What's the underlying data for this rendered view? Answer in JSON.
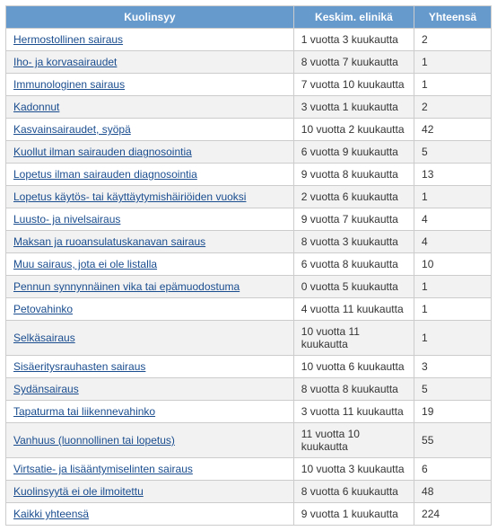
{
  "headers": {
    "cause": "Kuolinsyy",
    "avg_life": "Keskim. elinikä",
    "total": "Yhteensä"
  },
  "rows": [
    {
      "cause": "Hermostollinen sairaus",
      "avg_life": "1 vuotta 3 kuukautta",
      "total": "2"
    },
    {
      "cause": "Iho- ja korvasairaudet",
      "avg_life": "8 vuotta 7 kuukautta",
      "total": "1"
    },
    {
      "cause": "Immunologinen sairaus",
      "avg_life": "7 vuotta 10 kuukautta",
      "total": "1"
    },
    {
      "cause": "Kadonnut",
      "avg_life": "3 vuotta 1 kuukautta",
      "total": "2"
    },
    {
      "cause": "Kasvainsairaudet, syöpä",
      "avg_life": "10 vuotta 2 kuukautta",
      "total": "42"
    },
    {
      "cause": "Kuollut ilman sairauden diagnosointia",
      "avg_life": "6 vuotta 9 kuukautta",
      "total": "5"
    },
    {
      "cause": "Lopetus ilman sairauden diagnosointia",
      "avg_life": "9 vuotta 8 kuukautta",
      "total": "13"
    },
    {
      "cause": "Lopetus käytös- tai käyttäytymishäiriöiden vuoksi",
      "avg_life": "2 vuotta 6 kuukautta",
      "total": "1"
    },
    {
      "cause": "Luusto- ja nivelsairaus",
      "avg_life": "9 vuotta 7 kuukautta",
      "total": "4"
    },
    {
      "cause": "Maksan ja ruoansulatuskanavan sairaus",
      "avg_life": "8 vuotta 3 kuukautta",
      "total": "4"
    },
    {
      "cause": "Muu sairaus, jota ei ole listalla",
      "avg_life": "6 vuotta 8 kuukautta",
      "total": "10"
    },
    {
      "cause": "Pennun synnynnäinen vika tai epämuodostuma",
      "avg_life": "0 vuotta 5 kuukautta",
      "total": "1"
    },
    {
      "cause": "Petovahinko",
      "avg_life": "4 vuotta 11 kuukautta",
      "total": "1"
    },
    {
      "cause": "Selkäsairaus",
      "avg_life": "10 vuotta 11 kuukautta",
      "total": "1"
    },
    {
      "cause": "Sisäeritysrauhasten sairaus",
      "avg_life": "10 vuotta 6 kuukautta",
      "total": "3"
    },
    {
      "cause": "Sydänsairaus",
      "avg_life": "8 vuotta 8 kuukautta",
      "total": "5"
    },
    {
      "cause": "Tapaturma tai liikennevahinko",
      "avg_life": "3 vuotta 11 kuukautta",
      "total": "19"
    },
    {
      "cause": "Vanhuus (luonnollinen tai lopetus)",
      "avg_life": "11 vuotta 10 kuukautta",
      "total": "55"
    },
    {
      "cause": "Virtsatie- ja lisääntymiselinten sairaus",
      "avg_life": "10 vuotta 3 kuukautta",
      "total": "6"
    },
    {
      "cause": "Kuolinsyytä ei ole ilmoitettu",
      "avg_life": "8 vuotta 6 kuukautta",
      "total": "48"
    },
    {
      "cause": "Kaikki yhteensä",
      "avg_life": "9 vuotta 1 kuukautta",
      "total": "224"
    }
  ]
}
